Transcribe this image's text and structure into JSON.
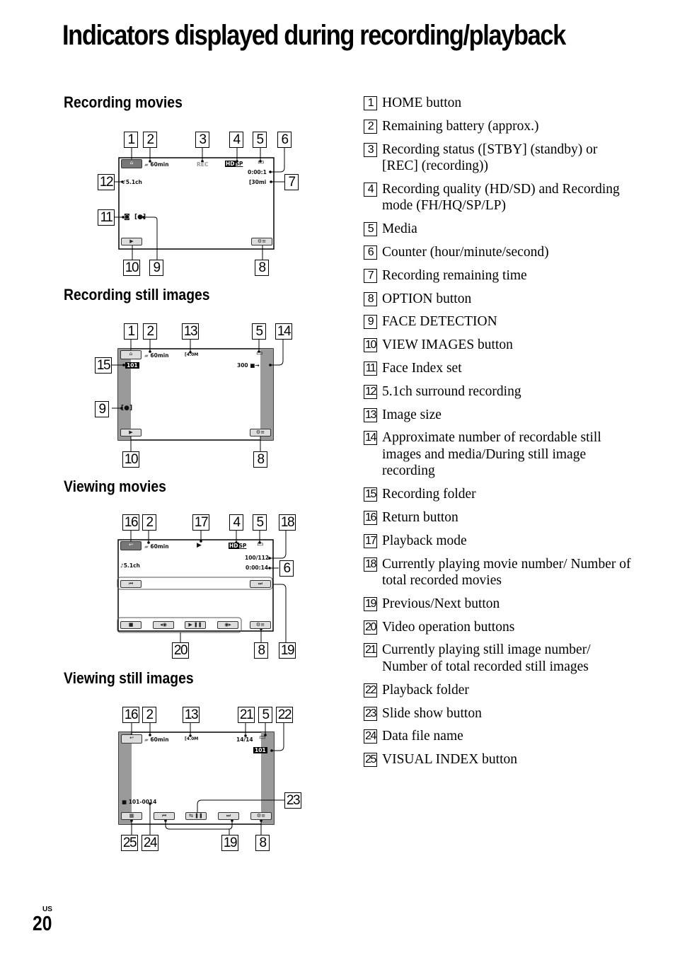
{
  "page": {
    "title": "Indicators displayed during recording/playback",
    "footer_region": "US",
    "page_number": "20"
  },
  "sections": {
    "recording_movies": "Recording movies",
    "recording_still": "Recording still images",
    "viewing_movies": "Viewing movies",
    "viewing_still": "Viewing still images"
  },
  "legend": [
    {
      "num": "1",
      "text": "HOME button"
    },
    {
      "num": "2",
      "text": "Remaining battery (approx.)"
    },
    {
      "num": "3",
      "text": "Recording status ([STBY] (standby) or [REC] (recording))"
    },
    {
      "num": "4",
      "text": "Recording quality (HD/SD) and Recording mode (FH/HQ/SP/LP)"
    },
    {
      "num": "5",
      "text": "Media"
    },
    {
      "num": "6",
      "text": "Counter (hour/minute/second)"
    },
    {
      "num": "7",
      "text": "Recording remaining time"
    },
    {
      "num": "8",
      "text": "OPTION button"
    },
    {
      "num": "9",
      "text": "FACE DETECTION"
    },
    {
      "num": "10",
      "text": "VIEW IMAGES button"
    },
    {
      "num": "11",
      "text": "Face Index set"
    },
    {
      "num": "12",
      "text": "5.1ch surround recording"
    },
    {
      "num": "13",
      "text": "Image size"
    },
    {
      "num": "14",
      "text": "Approximate number of recordable still images and media/During still image recording"
    },
    {
      "num": "15",
      "text": "Recording folder"
    },
    {
      "num": "16",
      "text": "Return button"
    },
    {
      "num": "17",
      "text": "Playback mode"
    },
    {
      "num": "18",
      "text": "Currently playing movie number/ Number of total recorded movies"
    },
    {
      "num": "19",
      "text": "Previous/Next button"
    },
    {
      "num": "20",
      "text": "Video operation buttons"
    },
    {
      "num": "21",
      "text": "Currently playing still image number/ Number of total recorded still images"
    },
    {
      "num": "22",
      "text": "Playback folder"
    },
    {
      "num": "23",
      "text": "Slide show button"
    },
    {
      "num": "24",
      "text": "Data file name"
    },
    {
      "num": "25",
      "text": "VISUAL INDEX button"
    }
  ],
  "diagrams": {
    "rec_movie": {
      "battery": "60min",
      "status": "REC",
      "quality": "HD",
      "mode": "SP",
      "counter": "0:00:1",
      "remaining": "[30mi",
      "surround": "♪5.1ch",
      "callouts": [
        "1",
        "2",
        "3",
        "4",
        "5",
        "6",
        "7",
        "8",
        "9",
        "10",
        "11",
        "12"
      ],
      "icons": {
        "home": "home-icon",
        "view": "view-images-icon",
        "option": "option-icon"
      }
    },
    "rec_still": {
      "battery": "60min",
      "image_size": "4.0M",
      "shots": "300",
      "folder": "101",
      "callouts": [
        "1",
        "2",
        "13",
        "5",
        "14",
        "15",
        "9",
        "10",
        "8"
      ]
    },
    "view_movie": {
      "battery": "60min",
      "quality": "HD",
      "mode": "SP",
      "movie_count": "100/112",
      "counter": "0:00:14",
      "surround": "♪5.1ch",
      "callouts": [
        "16",
        "2",
        "17",
        "4",
        "5",
        "18",
        "6",
        "20",
        "8",
        "19"
      ]
    },
    "view_still": {
      "battery": "60min",
      "image_size": "4.0M",
      "image_count": "14/14",
      "folder": "101",
      "file_name": "101-0014",
      "callouts": [
        "16",
        "2",
        "13",
        "21",
        "5",
        "22",
        "23",
        "25",
        "24",
        "19",
        "8"
      ]
    }
  }
}
